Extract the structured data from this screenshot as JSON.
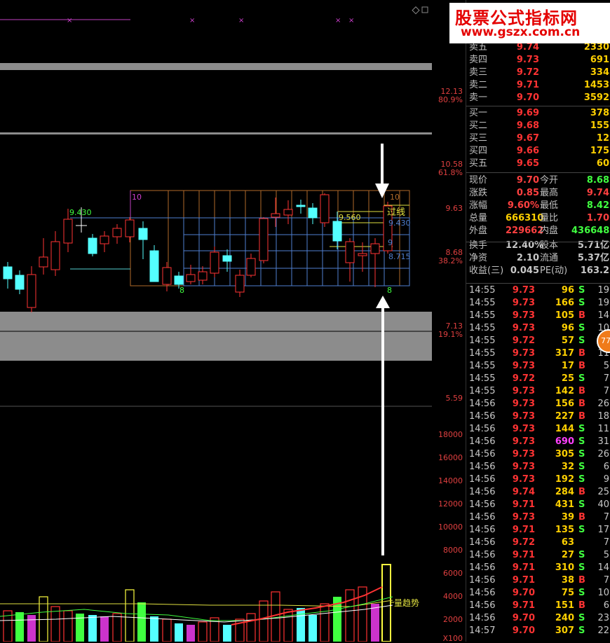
{
  "watermark": {
    "title": "股票公式指标网",
    "url": "www.gszx.com.cn"
  },
  "badge": "77",
  "price_axis": [
    {
      "v": "12.13",
      "c": "#e04040"
    },
    {
      "v": "80.9%",
      "c": "#e04040"
    },
    {
      "v": "10.58",
      "c": "#e04040"
    },
    {
      "v": "61.8%",
      "c": "#e04040"
    },
    {
      "v": "9.63",
      "c": "#e04040"
    },
    {
      "v": "8.68",
      "c": "#e04040"
    },
    {
      "v": "38.2%",
      "c": "#e04040"
    },
    {
      "v": "7.13",
      "c": "#e04040"
    },
    {
      "v": "19.1%",
      "c": "#e04040"
    },
    {
      "v": "5.59",
      "c": "#e04040"
    }
  ],
  "volume_axis": [
    "18000",
    "16000",
    "14000",
    "12000",
    "10000",
    "8000",
    "6000",
    "4000",
    "2000",
    "X100"
  ],
  "chart_labels": {
    "box_top": "10",
    "box_top_right": "10",
    "box_bottom": "8",
    "box_bottom_right": "8",
    "support_price": "9.430",
    "resist_price": "9.560",
    "right_price_1": "9.430",
    "right_price_2": "8.715",
    "mid_marker": "9",
    "breakout_label": "过线",
    "trend_label": "量趋势"
  },
  "sell": [
    {
      "label": "卖五",
      "price": "9.74",
      "vol": "2330"
    },
    {
      "label": "卖四",
      "price": "9.73",
      "vol": "691"
    },
    {
      "label": "卖三",
      "price": "9.72",
      "vol": "334"
    },
    {
      "label": "卖二",
      "price": "9.71",
      "vol": "1453"
    },
    {
      "label": "卖一",
      "price": "9.70",
      "vol": "3592"
    }
  ],
  "buy": [
    {
      "label": "买一",
      "price": "9.69",
      "vol": "378"
    },
    {
      "label": "买二",
      "price": "9.68",
      "vol": "155"
    },
    {
      "label": "买三",
      "price": "9.67",
      "vol": "12"
    },
    {
      "label": "买四",
      "price": "9.66",
      "vol": "175"
    },
    {
      "label": "买五",
      "price": "9.65",
      "vol": "60"
    }
  ],
  "quote": [
    {
      "l1": "现价",
      "v1": "9.70",
      "c1": "#ff4040",
      "l2": "今开",
      "v2": "8.68",
      "c2": "#40ff40"
    },
    {
      "l1": "涨跌",
      "v1": "0.85",
      "c1": "#ff4040",
      "l2": "最高",
      "v2": "9.74",
      "c2": "#ff4040"
    },
    {
      "l1": "涨幅",
      "v1": "9.60%",
      "c1": "#ff4040",
      "l2": "最低",
      "v2": "8.42",
      "c2": "#40ff40"
    },
    {
      "l1": "总量",
      "v1": "666310",
      "c1": "#ffd000",
      "l2": "量比",
      "v2": "1.70",
      "c2": "#ff4040"
    },
    {
      "l1": "外盘",
      "v1": "229662",
      "c1": "#ff4040",
      "l2": "内盘",
      "v2": "436648",
      "c2": "#40ff40"
    },
    {
      "l1": "换手",
      "v1": "12.40%",
      "c1": "#c8c8c8",
      "l2": "股本",
      "v2": "5.71亿",
      "c2": "#c8c8c8"
    },
    {
      "l1": "净资",
      "v1": "2.10",
      "c1": "#c8c8c8",
      "l2": "流通",
      "v2": "5.37亿",
      "c2": "#c8c8c8"
    },
    {
      "l1": "收益(三)",
      "v1": "0.045",
      "c1": "#c8c8c8",
      "l2": "PE(动)",
      "v2": "163.2",
      "c2": "#c8c8c8"
    }
  ],
  "ticks": [
    {
      "t": "14:55",
      "p": "9.73",
      "v": "96",
      "s": "S",
      "n": "19"
    },
    {
      "t": "14:55",
      "p": "9.73",
      "v": "166",
      "s": "S",
      "n": "19"
    },
    {
      "t": "14:55",
      "p": "9.73",
      "v": "105",
      "s": "B",
      "n": "14"
    },
    {
      "t": "14:55",
      "p": "9.73",
      "v": "96",
      "s": "S",
      "n": "10"
    },
    {
      "t": "14:55",
      "p": "9.72",
      "v": "57",
      "s": "S",
      "n": "8"
    },
    {
      "t": "14:55",
      "p": "9.73",
      "v": "317",
      "s": "B",
      "n": "11"
    },
    {
      "t": "14:55",
      "p": "9.73",
      "v": "17",
      "s": "B",
      "n": "5"
    },
    {
      "t": "14:55",
      "p": "9.72",
      "v": "25",
      "s": "S",
      "n": "7"
    },
    {
      "t": "14:55",
      "p": "9.73",
      "v": "142",
      "s": "B",
      "n": "7"
    },
    {
      "t": "14:56",
      "p": "9.73",
      "v": "156",
      "s": "B",
      "n": "26"
    },
    {
      "t": "14:56",
      "p": "9.73",
      "v": "227",
      "s": "B",
      "n": "18"
    },
    {
      "t": "14:56",
      "p": "9.73",
      "v": "144",
      "s": "S",
      "n": "11"
    },
    {
      "t": "14:56",
      "p": "9.73",
      "v": "690",
      "s": "S",
      "n": "31",
      "hl": true
    },
    {
      "t": "14:56",
      "p": "9.73",
      "v": "305",
      "s": "S",
      "n": "26"
    },
    {
      "t": "14:56",
      "p": "9.73",
      "v": "32",
      "s": "S",
      "n": "6"
    },
    {
      "t": "14:56",
      "p": "9.73",
      "v": "192",
      "s": "S",
      "n": "9"
    },
    {
      "t": "14:56",
      "p": "9.74",
      "v": "284",
      "s": "B",
      "n": "25"
    },
    {
      "t": "14:56",
      "p": "9.71",
      "v": "431",
      "s": "S",
      "n": "40"
    },
    {
      "t": "14:56",
      "p": "9.73",
      "v": "39",
      "s": "B",
      "n": "7"
    },
    {
      "t": "14:56",
      "p": "9.71",
      "v": "135",
      "s": "S",
      "n": "17"
    },
    {
      "t": "14:56",
      "p": "9.72",
      "v": "63",
      "s": "",
      "n": "7"
    },
    {
      "t": "14:56",
      "p": "9.71",
      "v": "27",
      "s": "S",
      "n": "5"
    },
    {
      "t": "14:56",
      "p": "9.71",
      "v": "310",
      "s": "S",
      "n": "14"
    },
    {
      "t": "14:56",
      "p": "9.71",
      "v": "38",
      "s": "B",
      "n": "7"
    },
    {
      "t": "14:56",
      "p": "9.70",
      "v": "75",
      "s": "S",
      "n": "10"
    },
    {
      "t": "14:56",
      "p": "9.71",
      "v": "151",
      "s": "B",
      "n": "6"
    },
    {
      "t": "14:56",
      "p": "9.70",
      "v": "240",
      "s": "S",
      "n": "23"
    },
    {
      "t": "14:57",
      "p": "9.70",
      "v": "307",
      "s": "S",
      "n": "22"
    }
  ],
  "colors": {
    "up": "#ff3333",
    "down": "#54ffff",
    "buy": "#ff3333",
    "sell": "#40ff40",
    "highlight": "#ff40ff"
  }
}
